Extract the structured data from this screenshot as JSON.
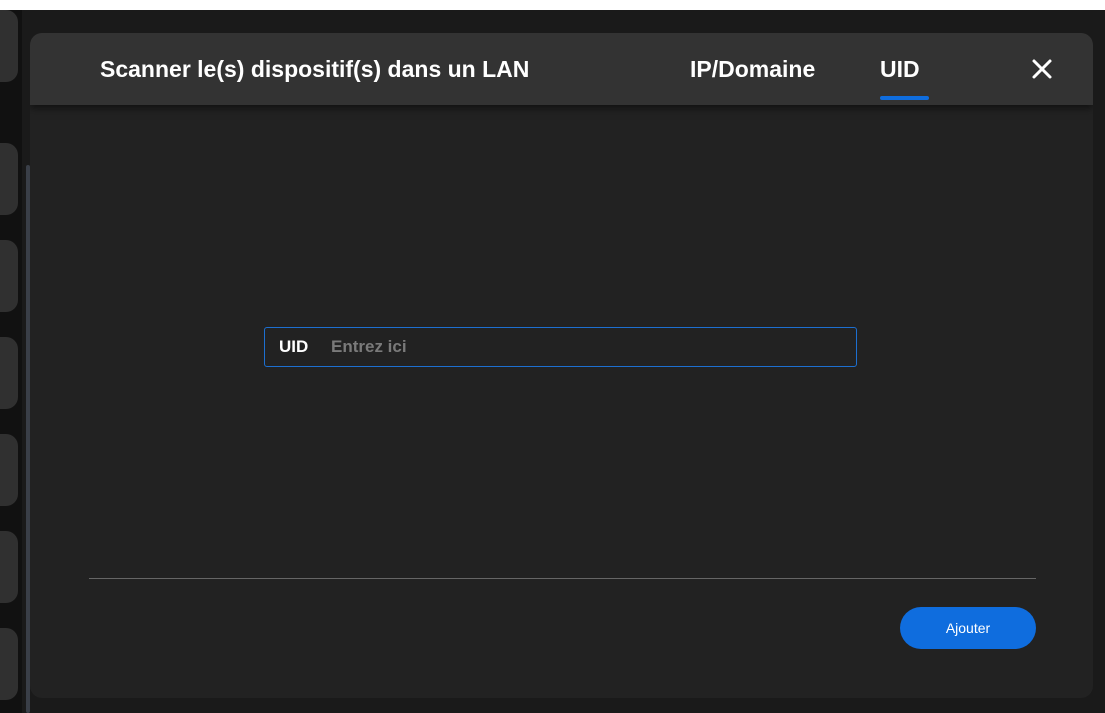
{
  "dialog": {
    "tabs": [
      {
        "label": "Scanner le(s) dispositif(s) dans un LAN",
        "active": false
      },
      {
        "label": "IP/Domaine",
        "active": false
      },
      {
        "label": "UID",
        "active": true
      }
    ],
    "close_icon": "close-icon"
  },
  "form": {
    "uid_label": "UID",
    "uid_value": "",
    "uid_placeholder": "Entrez ici"
  },
  "footer": {
    "add_label": "Ajouter"
  },
  "colors": {
    "accent": "#0f6dde",
    "dialog_bg": "#222222",
    "header_bg": "#333333",
    "input_border": "#1d6fd0",
    "placeholder": "#7a7a7a"
  }
}
